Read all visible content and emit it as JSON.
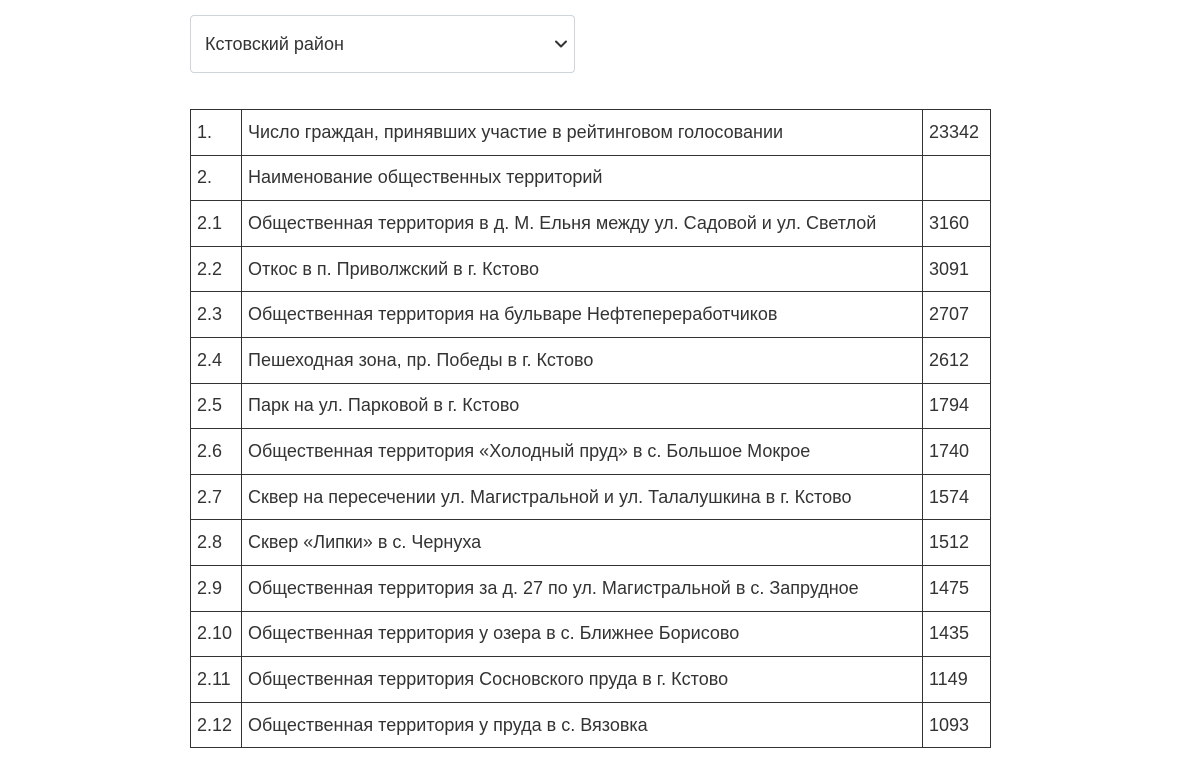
{
  "district_select": {
    "selected": "Кстовский район"
  },
  "table": {
    "rows": [
      {
        "num": "1.",
        "name": "Число граждан, принявших участие в рейтинговом голосовании",
        "votes": "23342"
      },
      {
        "num": "2.",
        "name": "Наименование общественных территорий",
        "votes": ""
      },
      {
        "num": "2.1",
        "name": "Общественная территория в д. М. Ельня между ул. Садовой и ул. Светлой",
        "votes": "3160"
      },
      {
        "num": "2.2",
        "name": "Откос в п. Приволжский в г. Кстово",
        "votes": "3091"
      },
      {
        "num": "2.3",
        "name": "Общественная территория на бульваре Нефтепереработчиков",
        "votes": "2707"
      },
      {
        "num": "2.4",
        "name": "Пешеходная зона, пр. Победы в г. Кстово",
        "votes": "2612"
      },
      {
        "num": "2.5",
        "name": "Парк на ул. Парковой в г. Кстово",
        "votes": "1794"
      },
      {
        "num": "2.6",
        "name": "Общественная территория «Холодный пруд» в с. Большое Мокрое",
        "votes": "1740"
      },
      {
        "num": "2.7",
        "name": "Сквер на пересечении ул. Магистральной и ул. Талалушкина в г. Кстово",
        "votes": "1574"
      },
      {
        "num": "2.8",
        "name": "Сквер «Липки» в с. Чернуха",
        "votes": "1512"
      },
      {
        "num": "2.9",
        "name": "Общественная территория за д. 27 по ул. Магистральной в с. Запрудное",
        "votes": "1475"
      },
      {
        "num": "2.10",
        "name": "Общественная территория у озера в с. Ближнее Борисово",
        "votes": "1435"
      },
      {
        "num": "2.11",
        "name": "Общественная территория Сосновского пруда в г. Кстово",
        "votes": "1149"
      },
      {
        "num": "2.12",
        "name": "Общественная территория у пруда в с. Вязовка",
        "votes": "1093"
      }
    ]
  }
}
